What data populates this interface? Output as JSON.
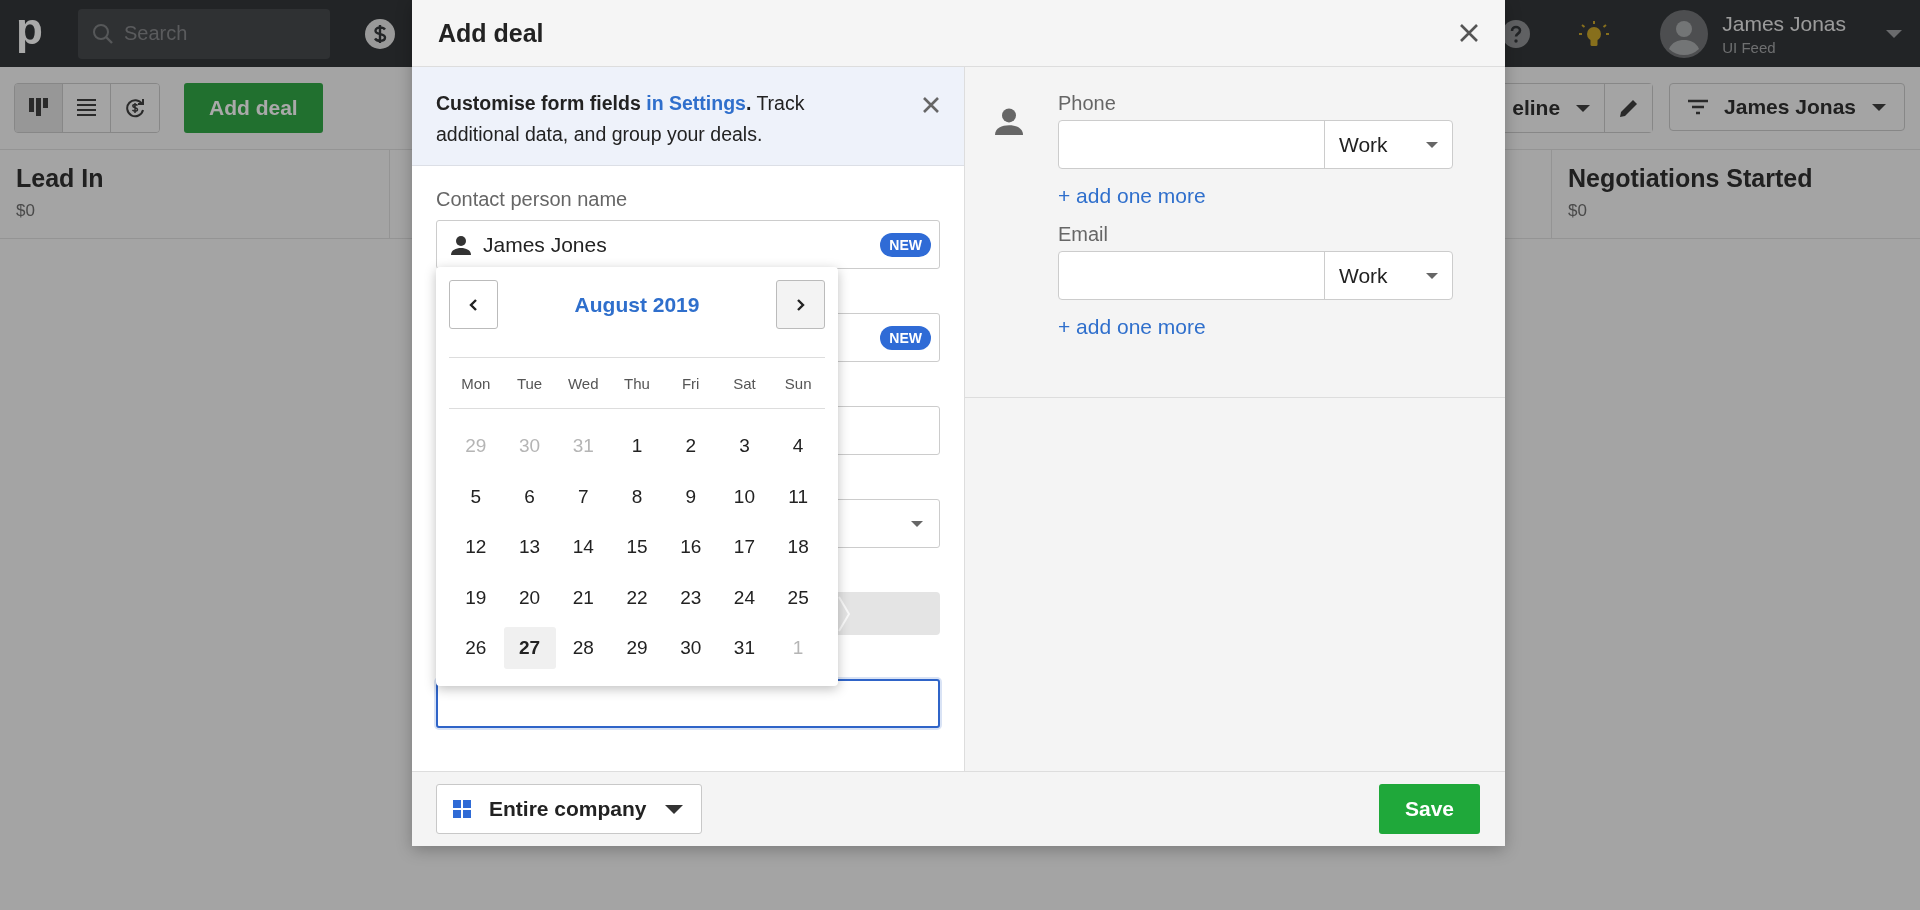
{
  "top_bar": {
    "logo": "p",
    "search": {
      "placeholder": "Search"
    },
    "user": {
      "name": "James Jonas",
      "subtitle": "UI Feed"
    }
  },
  "toolbar": {
    "views": [
      {
        "selected": true
      },
      {
        "selected": false
      },
      {
        "selected": false
      }
    ],
    "add_button": "Add deal",
    "pipeline_button": "eline",
    "filter_button": "James Jonas"
  },
  "stages": [
    {
      "name": "Lead In",
      "value": "$0"
    },
    {
      "name": "Negotiations Started",
      "value": "$0"
    }
  ],
  "modal": {
    "title": "Add deal",
    "banner": {
      "before": "**Customise form fields**",
      "link": "in Settings",
      "after": "**.** Track additional data, and group your deals."
    },
    "fields": [
      {
        "kind": "contact",
        "label": "Contact person name",
        "value": "James Jones",
        "badge": "NEW",
        "focused": false
      },
      {
        "kind": "text",
        "badge": "NEW",
        "focused": false
      },
      {
        "kind": "text",
        "focused": false
      },
      {
        "kind": "select",
        "focused": false
      },
      {
        "kind": "stages"
      },
      {
        "kind": "text",
        "focused": true
      }
    ],
    "calendar": {
      "month": "August 2019",
      "weekdays": [
        "Mon",
        "Tue",
        "Wed",
        "Thu",
        "Fri",
        "Sat",
        "Sun"
      ],
      "days": [
        {
          "day": "29",
          "outside_month": true,
          "selected": false
        },
        {
          "day": "30",
          "outside_month": true,
          "selected": false
        },
        {
          "day": "31",
          "outside_month": true,
          "selected": false
        },
        {
          "day": "1",
          "outside_month": false,
          "selected": false
        },
        {
          "day": "2",
          "outside_month": false,
          "selected": false
        },
        {
          "day": "3",
          "outside_month": false,
          "selected": false
        },
        {
          "day": "4",
          "outside_month": false,
          "selected": false
        },
        {
          "day": "5",
          "outside_month": false,
          "selected": false
        },
        {
          "day": "6",
          "outside_month": false,
          "selected": false
        },
        {
          "day": "7",
          "outside_month": false,
          "selected": false
        },
        {
          "day": "8",
          "outside_month": false,
          "selected": false
        },
        {
          "day": "9",
          "outside_month": false,
          "selected": false
        },
        {
          "day": "10",
          "outside_month": false,
          "selected": false
        },
        {
          "day": "11",
          "outside_month": false,
          "selected": false
        },
        {
          "day": "12",
          "outside_month": false,
          "selected": false
        },
        {
          "day": "13",
          "outside_month": false,
          "selected": false
        },
        {
          "day": "14",
          "outside_month": false,
          "selected": false
        },
        {
          "day": "15",
          "outside_month": false,
          "selected": false
        },
        {
          "day": "16",
          "outside_month": false,
          "selected": false
        },
        {
          "day": "17",
          "outside_month": false,
          "selected": false
        },
        {
          "day": "18",
          "outside_month": false,
          "selected": false
        },
        {
          "day": "19",
          "outside_month": false,
          "selected": false
        },
        {
          "day": "20",
          "outside_month": false,
          "selected": false
        },
        {
          "day": "21",
          "outside_month": false,
          "selected": false
        },
        {
          "day": "22",
          "outside_month": false,
          "selected": false
        },
        {
          "day": "23",
          "outside_month": false,
          "selected": false
        },
        {
          "day": "24",
          "outside_month": false,
          "selected": false
        },
        {
          "day": "25",
          "outside_month": false,
          "selected": false
        },
        {
          "day": "26",
          "outside_month": false,
          "selected": false
        },
        {
          "day": "27",
          "outside_month": false,
          "selected": true
        },
        {
          "day": "28",
          "outside_month": false,
          "selected": false
        },
        {
          "day": "29",
          "outside_month": false,
          "selected": false
        },
        {
          "day": "30",
          "outside_month": false,
          "selected": false
        },
        {
          "day": "31",
          "outside_month": false,
          "selected": false
        },
        {
          "day": "1",
          "outside_month": true,
          "selected": false
        }
      ]
    },
    "contact_details": [
      {
        "label": "Phone",
        "type": "Work",
        "link": "+ add one more"
      },
      {
        "label": "Email",
        "type": "Work",
        "link": "+ add one more"
      }
    ],
    "footer": {
      "visibility": "Entire company",
      "save_button": "Save"
    }
  }
}
